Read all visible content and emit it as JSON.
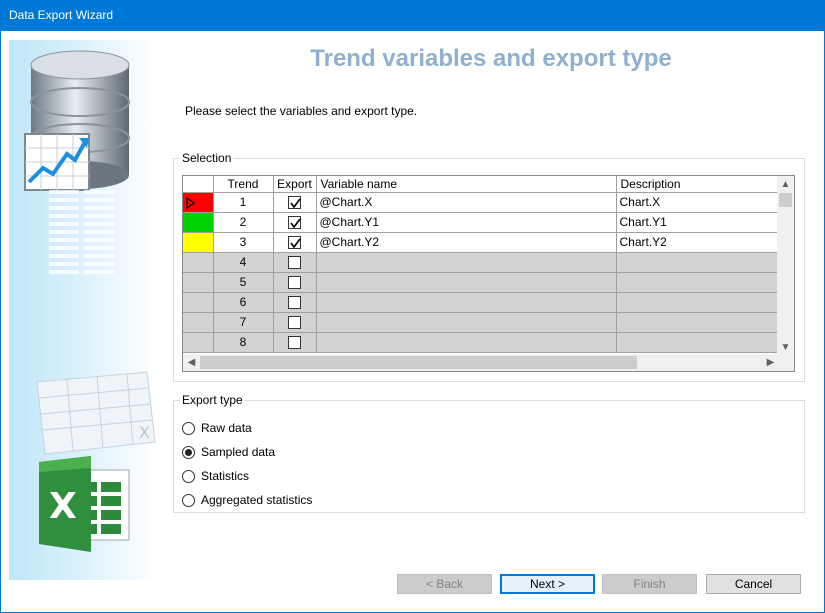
{
  "window": {
    "title": "Data Export Wizard"
  },
  "page": {
    "title": "Trend variables and export type",
    "instruction": "Please select the variables and export type."
  },
  "selection": {
    "label": "Selection",
    "columns": {
      "trend": "Trend",
      "export": "Export",
      "variable": "Variable name",
      "description": "Description"
    },
    "rows": [
      {
        "trend": "1",
        "export": true,
        "variable": "@Chart.X",
        "description": "Chart.X",
        "color": "#ff0000",
        "current": true
      },
      {
        "trend": "2",
        "export": true,
        "variable": "@Chart.Y1",
        "description": "Chart.Y1",
        "color": "#00d000",
        "current": false
      },
      {
        "trend": "3",
        "export": true,
        "variable": "@Chart.Y2",
        "description": "Chart.Y2",
        "color": "#ffff00",
        "current": false
      },
      {
        "trend": "4",
        "export": false,
        "variable": "",
        "description": "",
        "color": "",
        "current": false
      },
      {
        "trend": "5",
        "export": false,
        "variable": "",
        "description": "",
        "color": "",
        "current": false
      },
      {
        "trend": "6",
        "export": false,
        "variable": "",
        "description": "",
        "color": "",
        "current": false
      },
      {
        "trend": "7",
        "export": false,
        "variable": "",
        "description": "",
        "color": "",
        "current": false
      },
      {
        "trend": "8",
        "export": false,
        "variable": "",
        "description": "",
        "color": "",
        "current": false
      }
    ]
  },
  "export_type": {
    "label": "Export type",
    "options": [
      {
        "label": "Raw data",
        "checked": false
      },
      {
        "label": "Sampled data",
        "checked": true
      },
      {
        "label": "Statistics",
        "checked": false
      },
      {
        "label": "Aggregated statistics",
        "checked": false
      }
    ]
  },
  "buttons": {
    "back": "< Back",
    "next": "Next >",
    "finish": "Finish",
    "cancel": "Cancel"
  },
  "icons": {
    "side": [
      "database-icon",
      "chart-icon",
      "spreadsheet-icon",
      "excel-icon"
    ]
  },
  "colors": {
    "accent": "#0078d7",
    "title": "#8fb0cf"
  }
}
